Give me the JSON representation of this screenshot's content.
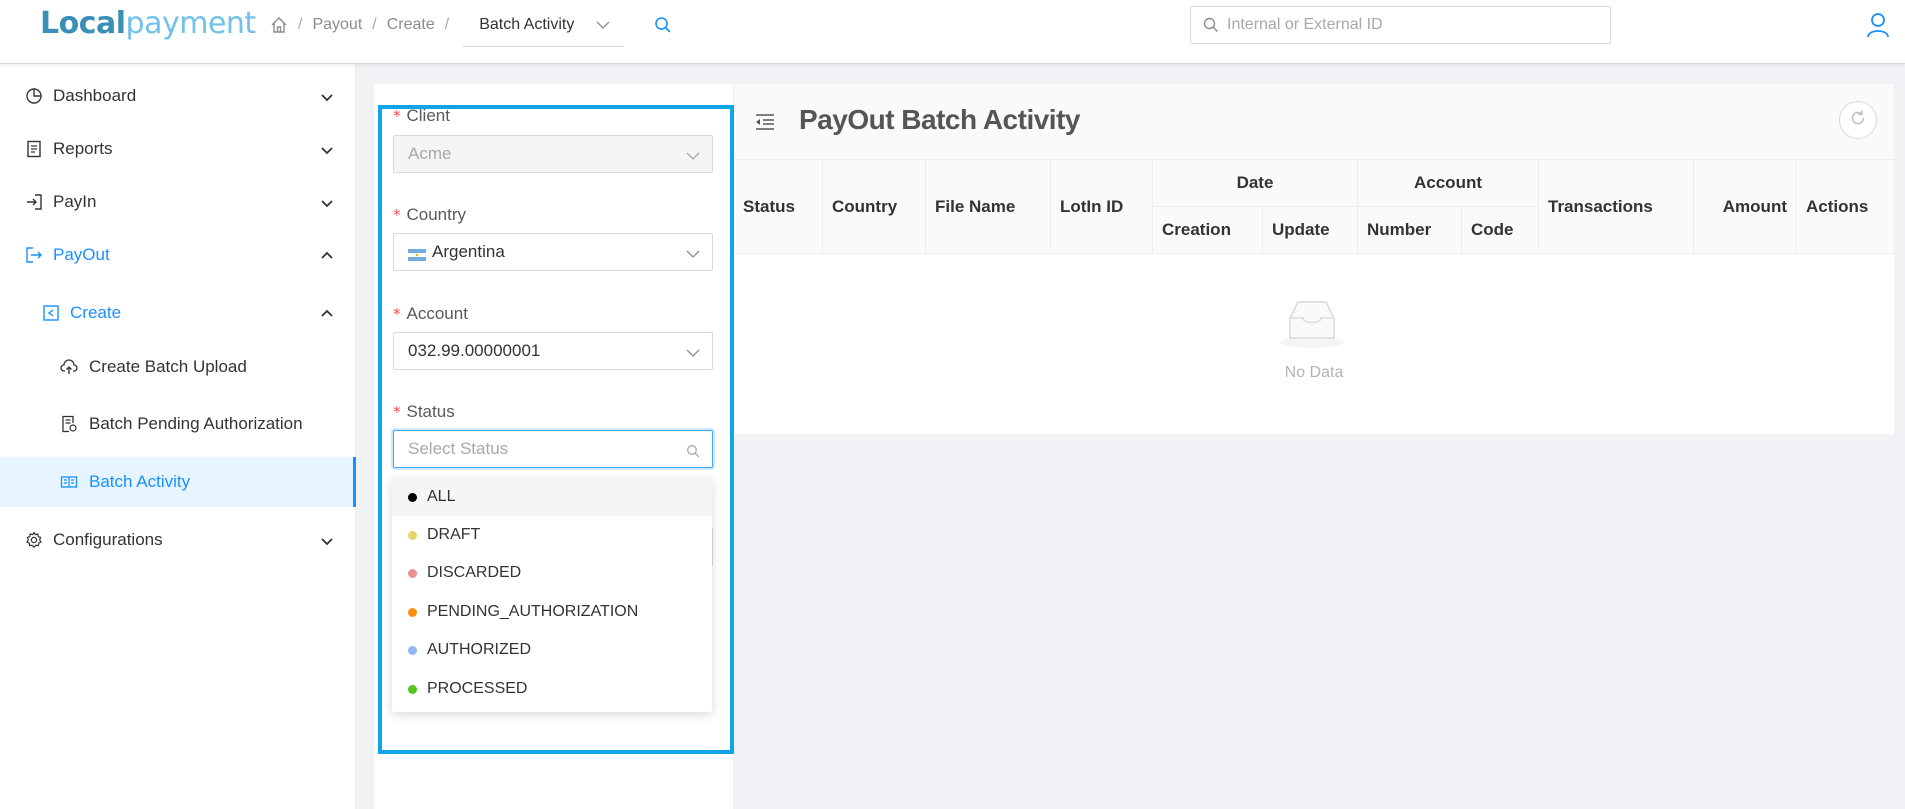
{
  "header": {
    "logo_part1": "Local",
    "logo_part2": "payment",
    "breadcrumb": [
      "Payout",
      "Create"
    ],
    "breadcrumb_separator": "/",
    "current_page": "Batch Activity",
    "search_placeholder": "Internal or External ID"
  },
  "sidebar": {
    "items": [
      {
        "label": "Dashboard"
      },
      {
        "label": "Reports"
      },
      {
        "label": "PayIn"
      },
      {
        "label": "PayOut"
      },
      {
        "label": "Create"
      },
      {
        "label": "Create Batch Upload"
      },
      {
        "label": "Batch Pending Authorization"
      },
      {
        "label": "Batch Activity"
      },
      {
        "label": "Configurations"
      }
    ]
  },
  "form": {
    "required_mark": "*",
    "client": {
      "label": "Client",
      "value": "Acme"
    },
    "country": {
      "label": "Country",
      "value": "Argentina"
    },
    "account": {
      "label": "Account",
      "value": "032.99.00000001"
    },
    "status": {
      "label": "Status",
      "placeholder": "Select Status"
    }
  },
  "status_options": [
    {
      "label": "ALL",
      "color": "#000000"
    },
    {
      "label": "DRAFT",
      "color": "#e6d36a"
    },
    {
      "label": "DISCARDED",
      "color": "#ec8f8f"
    },
    {
      "label": "PENDING_AUTHORIZATION",
      "color": "#fa8c16"
    },
    {
      "label": "AUTHORIZED",
      "color": "#91b8f0"
    },
    {
      "label": "PROCESSED",
      "color": "#52c41a"
    }
  ],
  "table": {
    "title": "PayOut Batch Activity",
    "columns": {
      "status": "Status",
      "country": "Country",
      "file_name": "File Name",
      "lotin_id": "LotIn ID",
      "date": "Date",
      "creation": "Creation",
      "update": "Update",
      "account": "Account",
      "number": "Number",
      "code": "Code",
      "transactions": "Transactions",
      "amount": "Amount",
      "actions": "Actions"
    },
    "empty_text": "No Data"
  },
  "colors": {
    "accent": "#1890ff",
    "highlight": "#0ea5e9",
    "required": "#ff4d4f"
  }
}
